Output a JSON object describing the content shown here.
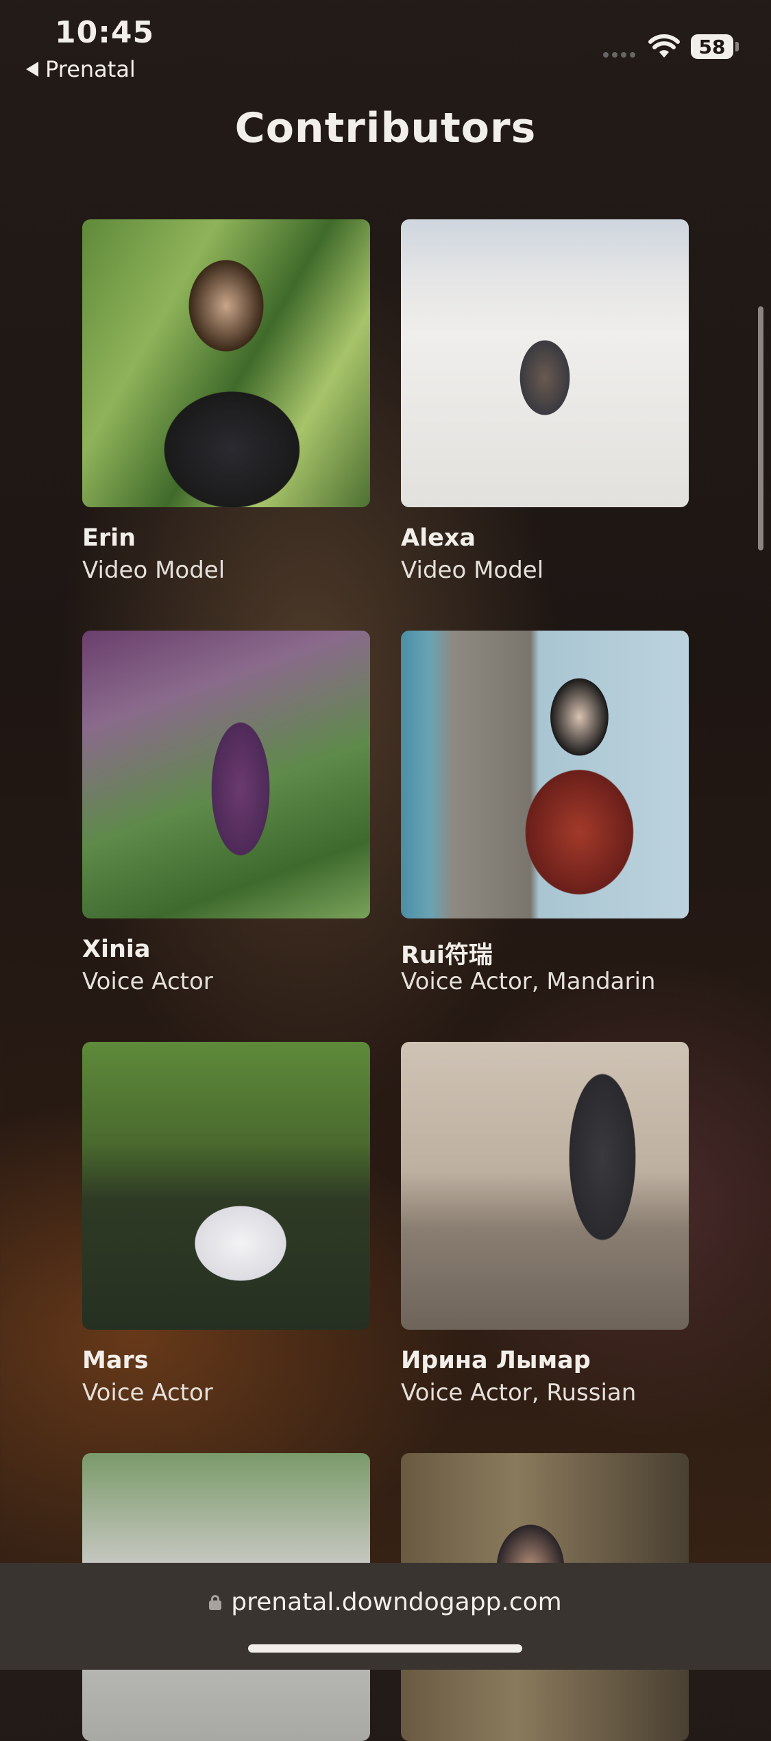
{
  "status_bar": {
    "time": "10:45",
    "back_label": "Prenatal",
    "battery": "58"
  },
  "page": {
    "title": "Contributors"
  },
  "contributors": [
    {
      "name": "Erin",
      "role": "Video Model"
    },
    {
      "name": "Alexa",
      "role": "Video Model"
    },
    {
      "name": "Xinia",
      "role": "Voice Actor"
    },
    {
      "name": "Rui符瑞",
      "role": "Voice Actor, Mandarin"
    },
    {
      "name": "Mars",
      "role": "Voice Actor"
    },
    {
      "name": "Ирина Лымар",
      "role": "Voice Actor, Russian"
    }
  ],
  "browser": {
    "url": "prenatal.downdogapp.com"
  },
  "colors": {
    "background": "#1e1613",
    "text": "#f2eee9",
    "bottom_bar": "#3a3430"
  }
}
